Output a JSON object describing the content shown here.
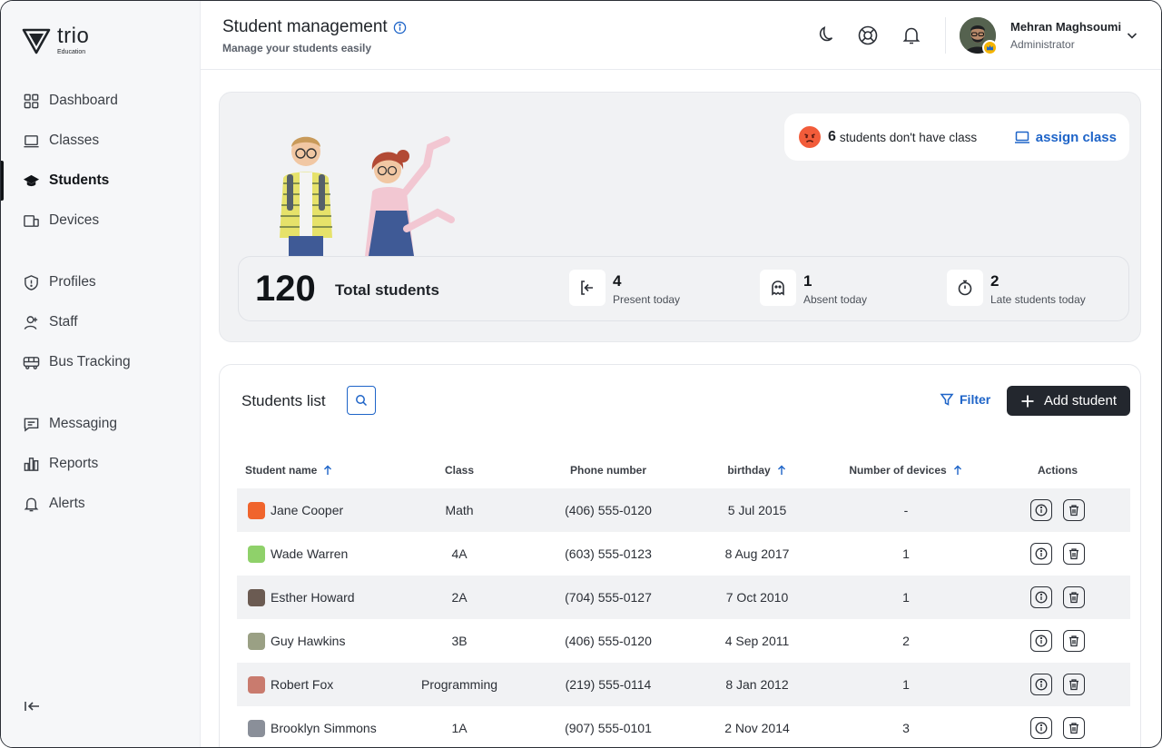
{
  "brand": {
    "name": "trio",
    "subtitle": "Education"
  },
  "sidebar": {
    "items": [
      {
        "label": "Dashboard",
        "icon": "grid-icon"
      },
      {
        "label": "Classes",
        "icon": "laptop-icon"
      },
      {
        "label": "Students",
        "icon": "graduation-cap-icon",
        "active": true
      },
      {
        "label": "Devices",
        "icon": "devices-icon"
      },
      {
        "label": "Profiles",
        "icon": "shield-icon"
      },
      {
        "label": "Staff",
        "icon": "user-icon"
      },
      {
        "label": "Bus Tracking",
        "icon": "bus-icon"
      },
      {
        "label": "Messaging",
        "icon": "message-icon"
      },
      {
        "label": "Reports",
        "icon": "bar-chart-icon"
      },
      {
        "label": "Alerts",
        "icon": "bell-icon"
      }
    ],
    "collapse_icon": "collapse-left-icon"
  },
  "header": {
    "title": "Student management",
    "subtitle": "Manage your students easily",
    "user": {
      "name": "Mehran Maghsoumi",
      "role": "Administrator"
    }
  },
  "summary": {
    "no_class_count": "6",
    "no_class_text": "students don't have class",
    "assign_label": "assign class",
    "total_number": "120",
    "total_label": "Total students",
    "stats": [
      {
        "value": "4",
        "label": "Present today",
        "icon": "login-icon"
      },
      {
        "value": "1",
        "label": "Absent today",
        "icon": "ghost-icon"
      },
      {
        "value": "2",
        "label": "Late students today",
        "icon": "timer-icon"
      }
    ]
  },
  "list": {
    "title": "Students list",
    "filter_label": "Filter",
    "add_label": "Add student",
    "columns": [
      "Student name",
      "Class",
      "Phone number",
      "birthday",
      "Number of devices",
      "Actions"
    ],
    "rows": [
      {
        "name": "Jane Cooper",
        "class": "Math",
        "phone": "(406) 555-0120",
        "birthday": "5 Jul 2015",
        "devices": "-"
      },
      {
        "name": "Wade Warren",
        "class": "4A",
        "phone": "(603) 555-0123",
        "birthday": "8 Aug 2017",
        "devices": "1"
      },
      {
        "name": "Esther Howard",
        "class": "2A",
        "phone": "(704) 555-0127",
        "birthday": "7 Oct 2010",
        "devices": "1"
      },
      {
        "name": "Guy Hawkins",
        "class": "3B",
        "phone": "(406) 555-0120",
        "birthday": "4 Sep 2011",
        "devices": "2"
      },
      {
        "name": "Robert Fox",
        "class": "Programming",
        "phone": "(219) 555-0114",
        "birthday": "8 Jan 2012",
        "devices": "1"
      },
      {
        "name": "Brooklyn Simmons",
        "class": "1A",
        "phone": "(907) 555-0101",
        "birthday": "2 Nov 2014",
        "devices": "3"
      }
    ]
  },
  "colors": {
    "accent": "#1e64c8",
    "dark_button": "#23272e",
    "row_shade": "#f1f2f4",
    "emoji": "#f25c3a"
  }
}
